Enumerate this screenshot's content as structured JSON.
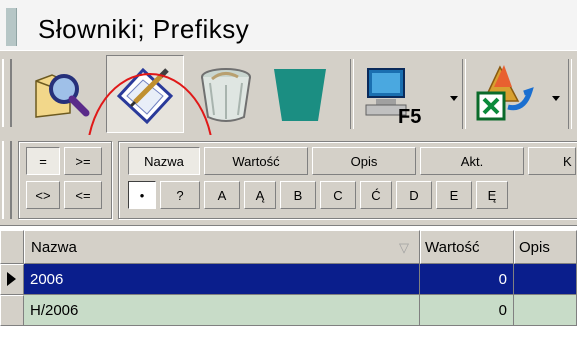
{
  "window": {
    "title": "Słowniki; Prefiksy"
  },
  "toolbar": {
    "buttons": [
      {
        "name": "search-records-button",
        "icon": "magnifier-folder-icon"
      },
      {
        "name": "edit-record-button",
        "icon": "clipboard-pencil-icon",
        "pressed": true
      },
      {
        "name": "delete-record-button",
        "icon": "trash-bin-icon"
      },
      {
        "name": "export-button",
        "icon": "bucket-icon"
      },
      {
        "name": "refresh-button",
        "icon": "monitor-f5-icon",
        "badge": "F5"
      },
      {
        "name": "excel-export-button",
        "icon": "excel-arrow-icon"
      }
    ],
    "refresh_badge": "F5",
    "annotation_color": "#e01818"
  },
  "filter": {
    "operators": [
      "=",
      ">=",
      "<>",
      "<="
    ],
    "columns": [
      "Nazwa",
      "Wartość",
      "Opis",
      "Akt.",
      "K"
    ],
    "letters": [
      "•",
      "?",
      "A",
      "Ą",
      "B",
      "C",
      "Ć",
      "D",
      "E",
      "Ę"
    ]
  },
  "grid": {
    "columns": [
      "Nazwa",
      "Wartość",
      "Opis"
    ],
    "sort_icon": "sort-triangle-icon",
    "rows": [
      {
        "nazwa": "2006",
        "wartosc": "0",
        "opis": "",
        "selected": true
      },
      {
        "nazwa": "H/2006",
        "wartosc": "0",
        "opis": "",
        "selected": false
      }
    ],
    "colors": {
      "selected_row": "#0a1e8c",
      "row": "#c8dcc8"
    }
  }
}
